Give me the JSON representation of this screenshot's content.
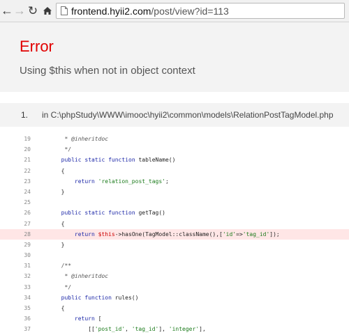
{
  "browser": {
    "url_host": "frontend.hyii2.com",
    "url_path": "/post/view?id=113"
  },
  "error": {
    "title": "Error",
    "message": "Using $this when not in object context"
  },
  "trace": {
    "number": "1.",
    "file": "in C:\\phpStudy\\WWW\\imooc\\hyii2\\common\\models\\RelationPostTagModel.php"
  },
  "code_lines": [
    {
      "n": "19",
      "text": "   * @inheritdoc"
    },
    {
      "n": "20",
      "text": "   */"
    },
    {
      "n": "21",
      "text": "  public static function tableName()"
    },
    {
      "n": "22",
      "text": "  {"
    },
    {
      "n": "23",
      "text": "      return 'relation_post_tags';"
    },
    {
      "n": "24",
      "text": "  }"
    },
    {
      "n": "25",
      "text": ""
    },
    {
      "n": "26",
      "text": "  public static function getTag()"
    },
    {
      "n": "27",
      "text": "  {"
    },
    {
      "n": "28",
      "text": "      return $this->hasOne(TagModel::className(),['id'=>'tag_id']);"
    },
    {
      "n": "29",
      "text": "  }"
    },
    {
      "n": "30",
      "text": ""
    },
    {
      "n": "31",
      "text": "  /**"
    },
    {
      "n": "32",
      "text": "   * @inheritdoc"
    },
    {
      "n": "33",
      "text": "   */"
    },
    {
      "n": "34",
      "text": "  public function rules()"
    },
    {
      "n": "35",
      "text": "  {"
    },
    {
      "n": "36",
      "text": "      return ["
    },
    {
      "n": "37",
      "text": "          [['post_id', 'tag_id'], 'integer'],"
    }
  ],
  "error_line": "28"
}
